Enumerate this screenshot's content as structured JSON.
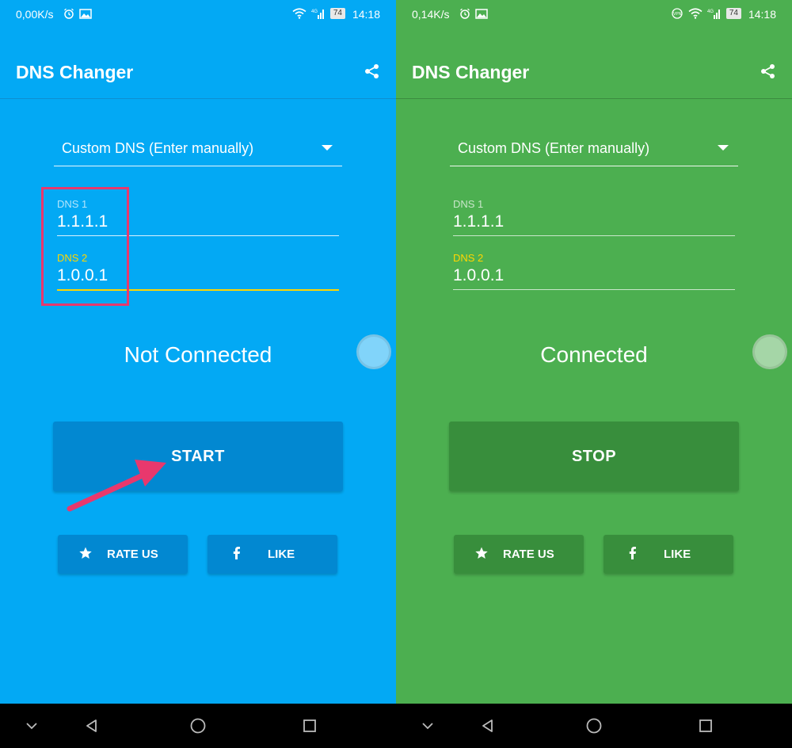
{
  "colors": {
    "blue_bg": "#03a9f4",
    "blue_button": "#0288d1",
    "blue_divider": "#0d8fd0",
    "blue_circle": "#81d4fa",
    "green_bg": "#4caf50",
    "green_button": "#388e3c",
    "green_divider": "#3b8b3f",
    "green_circle": "#a5d6a7",
    "label_gray": "#b3e5fc",
    "label_gray_green": "#c8e6c9",
    "label_yellow": "#ffd600",
    "highlight_pink": "#e8386d"
  },
  "left": {
    "statusbar": {
      "speed": "0,00K/s",
      "battery": "74",
      "time": "14:18"
    },
    "app_title": "DNS Changer",
    "dropdown_selected": "Custom DNS (Enter manually)",
    "dns1": {
      "label": "DNS 1",
      "value": "1.1.1.1"
    },
    "dns2": {
      "label": "DNS 2",
      "value": "1.0.0.1"
    },
    "connection_status": "Not Connected",
    "main_button_label": "START",
    "rate_label": "RATE US",
    "like_label": "LIKE"
  },
  "right": {
    "statusbar": {
      "speed": "0,14K/s",
      "battery": "74",
      "time": "14:18"
    },
    "app_title": "DNS Changer",
    "dropdown_selected": "Custom DNS (Enter manually)",
    "dns1": {
      "label": "DNS 1",
      "value": "1.1.1.1"
    },
    "dns2": {
      "label": "DNS 2",
      "value": "1.0.0.1"
    },
    "connection_status": "Connected",
    "main_button_label": "STOP",
    "rate_label": "RATE US",
    "like_label": "LIKE"
  },
  "icons": {
    "share": "share-icon",
    "star": "star-icon",
    "facebook": "facebook-icon",
    "alarm": "alarm-icon",
    "image": "image-icon",
    "wifi": "wifi-icon",
    "signal": "signal-icon",
    "vpn": "vpn-key-icon",
    "nav_down": "chevron-down-icon",
    "nav_back": "back-icon",
    "nav_home": "home-icon",
    "nav_recents": "recents-icon"
  }
}
